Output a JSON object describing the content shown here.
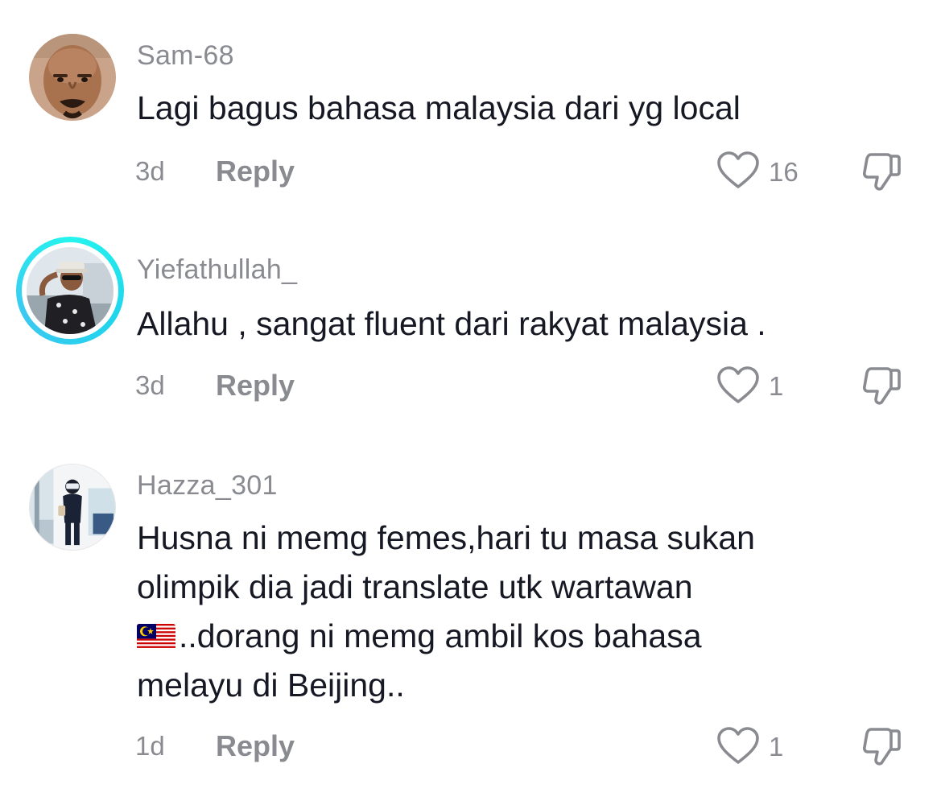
{
  "comments": [
    {
      "username": "Sam-68",
      "lines": [
        "Lagi bagus bahasa malaysia dari yg local"
      ],
      "time": "3d",
      "reply_label": "Reply",
      "likes": "16",
      "avatar_icon": "user-avatar-photo",
      "has_story_ring": false
    },
    {
      "username": "Yiefathullah_",
      "lines": [
        "Allahu , sangat fluent dari rakyat malaysia ."
      ],
      "time": "3d",
      "reply_label": "Reply",
      "likes": "1",
      "avatar_icon": "user-avatar-photo",
      "has_story_ring": true,
      "ring_color": "#25f4ee"
    },
    {
      "username": "Hazza_301",
      "lines": [
        "Husna ni memg femes,hari tu masa sukan",
        "olimpik dia jadi translate utk wartawan",
        "..dorang ni memg ambil kos bahasa",
        "melayu di Beijing.."
      ],
      "flag_emoji": "malaysia-flag-icon",
      "time": "1d",
      "reply_label": "Reply",
      "likes": "1",
      "avatar_icon": "user-avatar-photo",
      "has_story_ring": false
    }
  ],
  "icons": {
    "like": "heart-outline-icon",
    "dislike": "thumbs-down-outline-icon"
  },
  "colors": {
    "text_primary": "#161823",
    "text_secondary": "#8a8b91",
    "ring": "#25f4ee"
  }
}
